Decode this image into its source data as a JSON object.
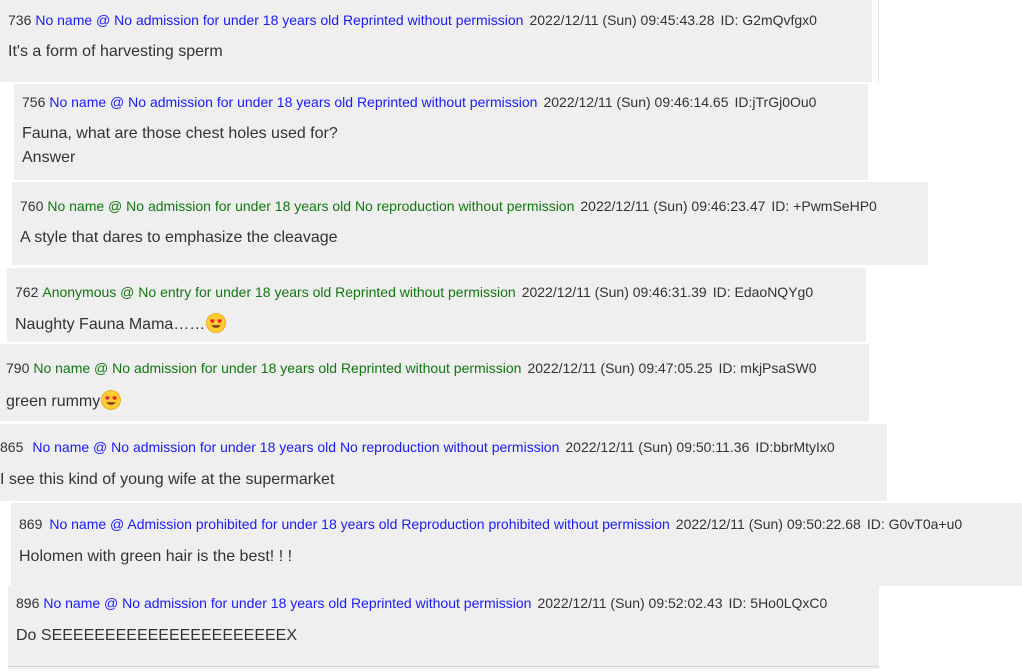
{
  "posts": [
    {
      "num": "736",
      "name": "No name @ No admission for under 18 years old Reprinted without permission",
      "name_color": "blue",
      "date": "2022/12/11 (Sun) 09:45:43.28",
      "id": "ID: G2mQvfgx0",
      "lines": [
        "It's a form of harvesting sperm"
      ]
    },
    {
      "num": "756",
      "name": "No name @ No admission for under 18 years old Reprinted without permission",
      "name_color": "blue",
      "date": "2022/12/11 (Sun) 09:46:14.65",
      "id": "ID:jTrGj0Ou0",
      "lines": [
        "Fauna, what are those chest holes used for?",
        "Answer"
      ]
    },
    {
      "num": "760",
      "name": "No name @ No admission for under 18 years old No reproduction without permission",
      "name_color": "green",
      "date": "2022/12/11 (Sun) 09:46:23.47",
      "id": "ID: +PwmSeHP0",
      "lines": [
        "A style that dares to emphasize the cleavage"
      ]
    },
    {
      "num": "762",
      "name": "Anonymous @ No entry for under 18 years old Reprinted without permission",
      "name_color": "green",
      "date": "2022/12/11 (Sun) 09:46:31.39",
      "id": "ID: EdaoNQYg0",
      "lines": [
        "Naughty Fauna Mama……"
      ],
      "emoji": "heart-eyes"
    },
    {
      "num": "790",
      "name": "No name @ No admission for under 18 years old Reprinted without permission",
      "name_color": "green",
      "date": "2022/12/11 (Sun) 09:47:05.25",
      "id": "ID: mkjPsaSW0",
      "lines": [
        "green rummy"
      ],
      "emoji": "heart-eyes"
    },
    {
      "num": "865",
      "name": "No name @ No admission for under 18 years old No reproduction without permission",
      "name_color": "blue",
      "date": "2022/12/11 (Sun) 09:50:11.36",
      "id": "ID:bbrMtyIx0",
      "lines": [
        "I see this kind of young wife at the supermarket"
      ]
    },
    {
      "num": "869",
      "name": "No name @ Admission prohibited for under 18 years old Reproduction prohibited without permission",
      "name_color": "blue",
      "date": "2022/12/11 (Sun) 09:50:22.68",
      "id": "ID: G0vT0a+u0",
      "lines": [
        "Holomen with green hair is the best! ! !"
      ]
    },
    {
      "num": "896",
      "name": "No name @ No admission for under 18 years old Reprinted without permission",
      "name_color": "blue",
      "date": "2022/12/11 (Sun) 09:52:02.43",
      "id": "ID: 5Ho0LQxC0",
      "lines": [
        "Do SEEEEEEEEEEEEEEEEEEEEEEX"
      ]
    }
  ]
}
